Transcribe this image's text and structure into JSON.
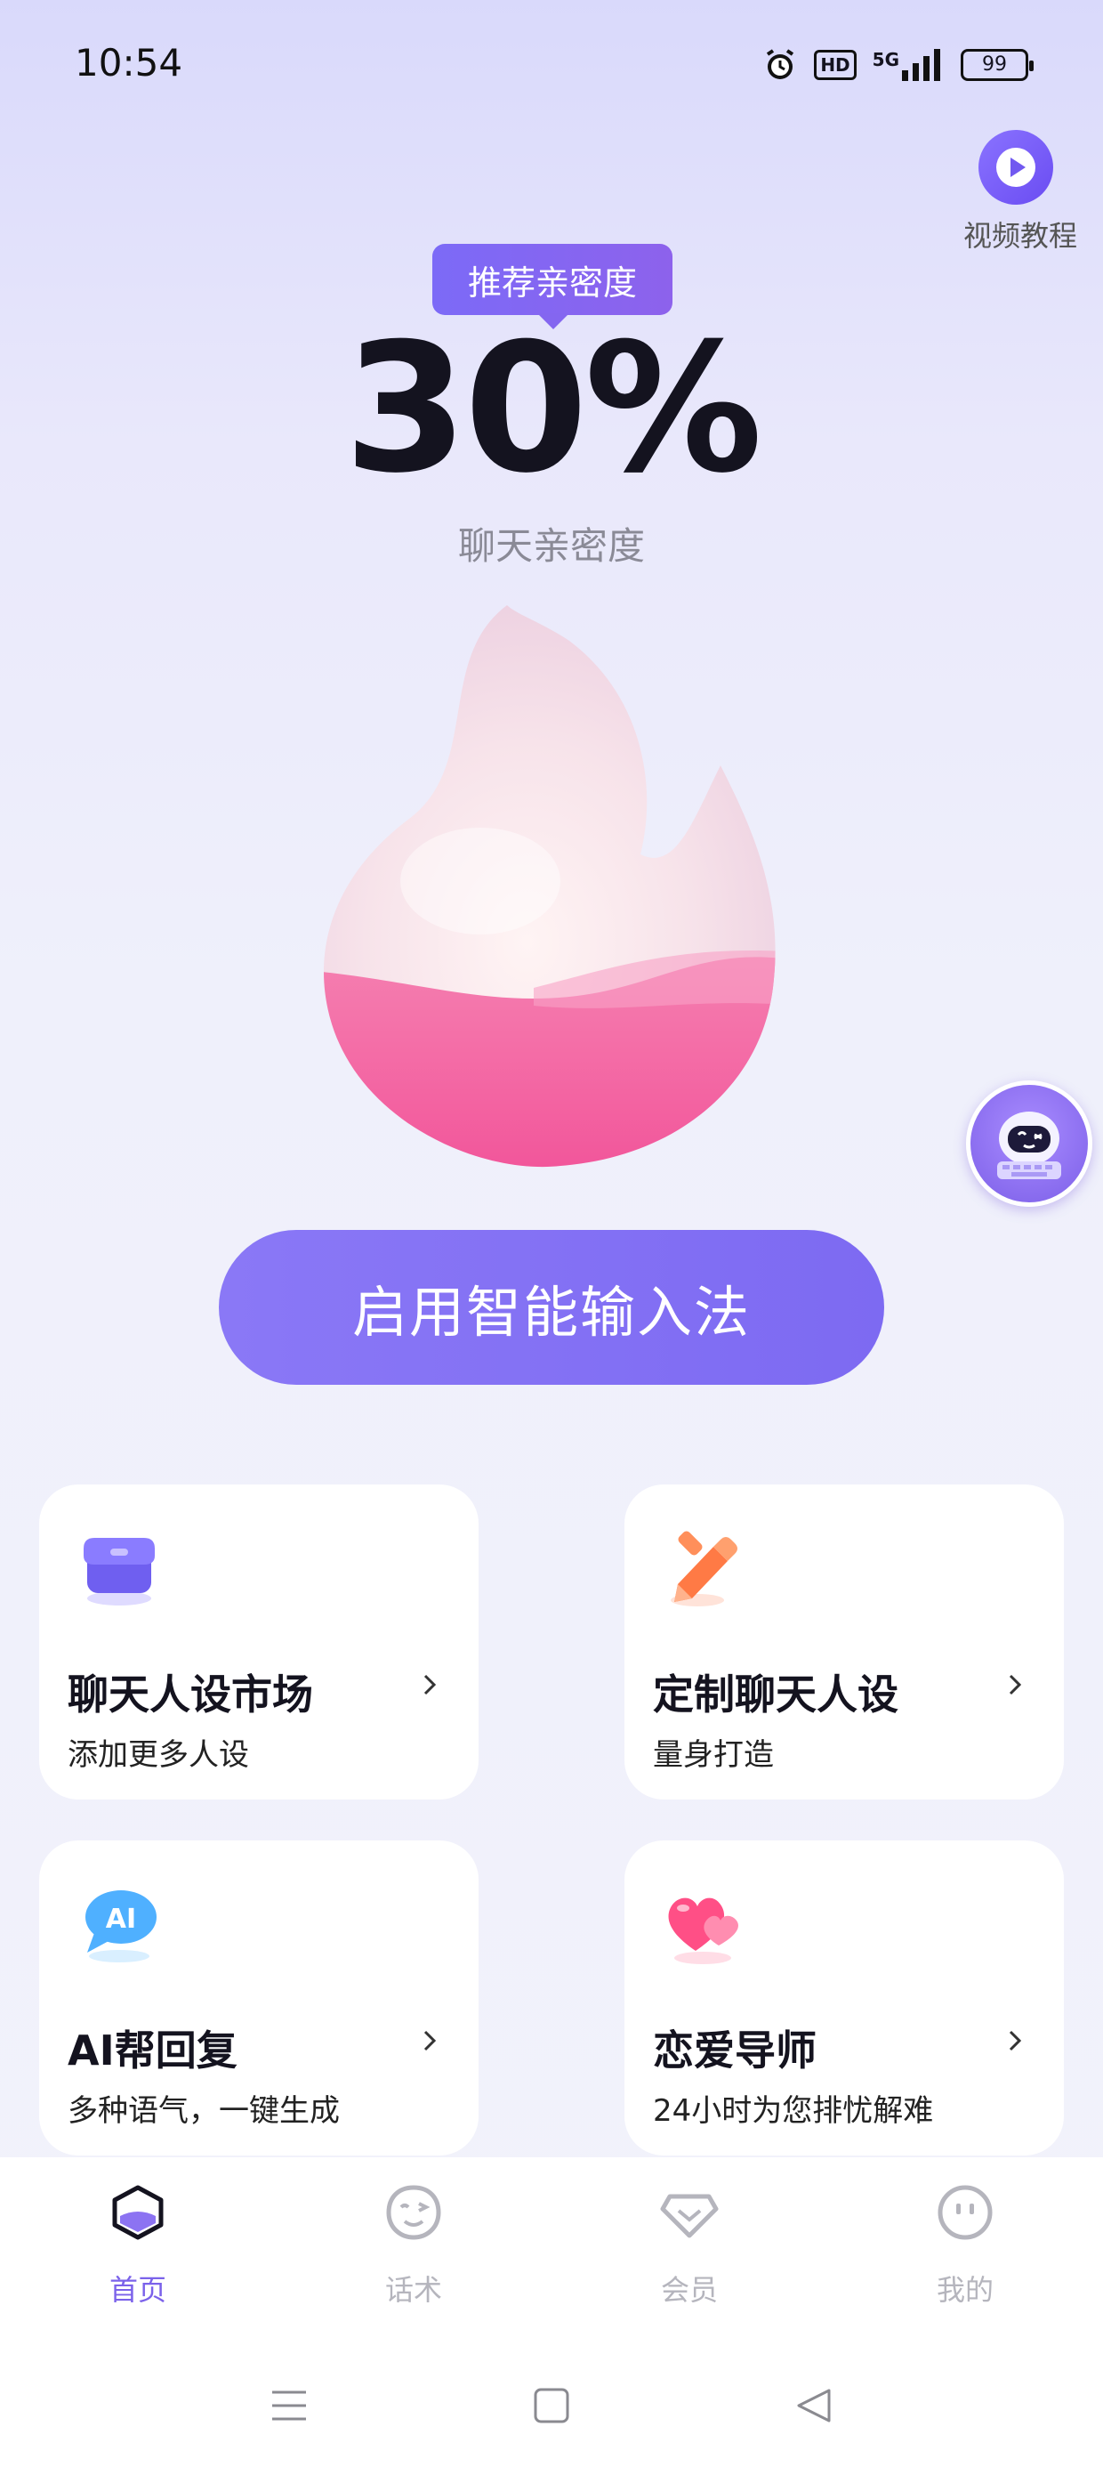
{
  "status_bar": {
    "time": "10:54",
    "hd": "HD",
    "network": "5G",
    "battery": "99"
  },
  "video_tutorial": {
    "label": "视频教程"
  },
  "intimacy": {
    "tag": "推荐亲密度",
    "value": "30%",
    "label": "聊天亲密度"
  },
  "main_button": {
    "label": "启用智能输入法"
  },
  "cards": [
    {
      "title": "聊天人设市场",
      "subtitle": "添加更多人设",
      "icon": "store-icon"
    },
    {
      "title": "定制聊天人设",
      "subtitle": "量身打造",
      "icon": "pencil-icon"
    },
    {
      "title": "AI帮回复",
      "subtitle": "多种语气，一键生成",
      "icon": "ai-chat-icon",
      "icon_text": "AI"
    },
    {
      "title": "恋爱导师",
      "subtitle": "24小时为您排忧解难",
      "icon": "hearts-icon"
    }
  ],
  "bottom_nav": [
    {
      "label": "首页",
      "icon": "home-icon",
      "active": true
    },
    {
      "label": "话术",
      "icon": "wink-face-icon",
      "active": false
    },
    {
      "label": "会员",
      "icon": "diamond-icon",
      "active": false
    },
    {
      "label": "我的",
      "icon": "profile-face-icon",
      "active": false
    }
  ],
  "colors": {
    "accent": "#7d6af2",
    "active_nav": "#7b62ea",
    "inactive_nav": "#b5b5bd"
  }
}
